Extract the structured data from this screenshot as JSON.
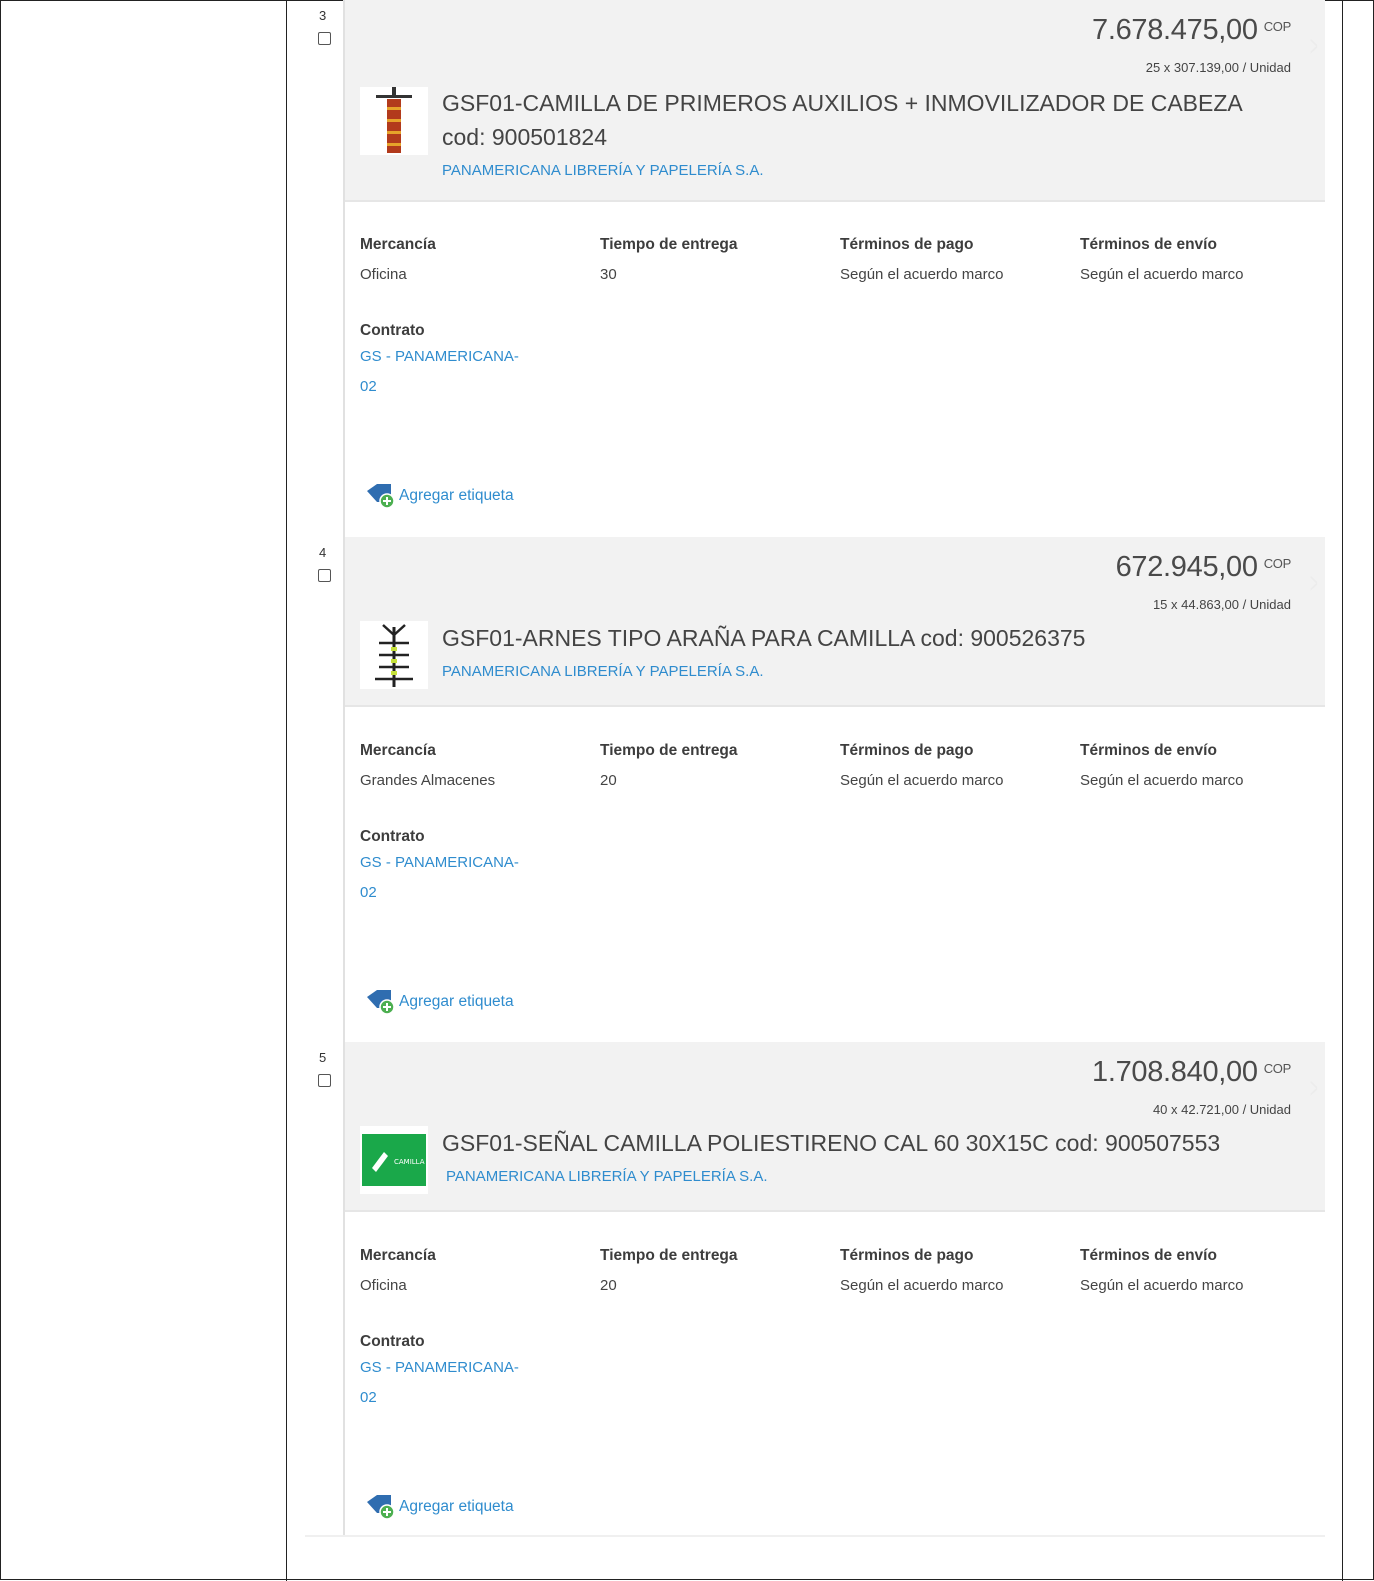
{
  "items": [
    {
      "num": "3",
      "price": "7.678.475,00",
      "currency": "COP",
      "qty": "25 x 307.139,00 / Unidad",
      "title": "GSF01-CAMILLA DE PRIMEROS AUXILIOS + INMOVILIZADOR DE CABEZA cod: 900501824",
      "vendor": "PANAMERICANA LIBRERÍA Y PAPELERÍA S.A.",
      "mercancia": "Oficina",
      "tiempo": "30",
      "pago": "Según el acuerdo marco",
      "envio": "Según el acuerdo marco",
      "contrato": "GS - PANAMERICANA-02",
      "thumb_icon": "stretcher-image"
    },
    {
      "num": "4",
      "price": "672.945,00",
      "currency": "COP",
      "qty": "15 x 44.863,00 / Unidad",
      "title": "GSF01-ARNES TIPO ARAÑA PARA CAMILLA cod: 900526375",
      "vendor": "PANAMERICANA LIBRERÍA Y PAPELERÍA S.A.",
      "mercancia": "Grandes Almacenes",
      "tiempo": "20",
      "pago": "Según el acuerdo marco",
      "envio": "Según el acuerdo marco",
      "contrato": "GS - PANAMERICANA-02",
      "thumb_icon": "spider-harness-image"
    },
    {
      "num": "5",
      "price": "1.708.840,00",
      "currency": "COP",
      "qty": "40 x 42.721,00 / Unidad",
      "title": "GSF01-SEÑAL CAMILLA POLIESTIRENO CAL 60 30X15C cod: 900507553",
      "vendor": "PANAMERICANA LIBRERÍA Y PAPELERÍA S.A.",
      "mercancia": "Oficina",
      "tiempo": "20",
      "pago": "Según el acuerdo marco",
      "envio": "Según el acuerdo marco",
      "contrato": "GS - PANAMERICANA-02",
      "thumb_icon": "stretcher-sign-image",
      "thumb_text": "CAMILLA"
    }
  ],
  "labels": {
    "mercancia": "Mercancía",
    "tiempo": "Tiempo de entrega",
    "pago": "Términos de pago",
    "envio": "Términos de envío",
    "contrato": "Contrato",
    "contrato_line1": "GS - PANAMERICANA-",
    "contrato_line2": "02",
    "add_tag": "Agregar etiqueta"
  },
  "colors": {
    "link": "#2f8cce",
    "header_bg": "#f2f2f2",
    "sign_green": "#1aa84a"
  }
}
